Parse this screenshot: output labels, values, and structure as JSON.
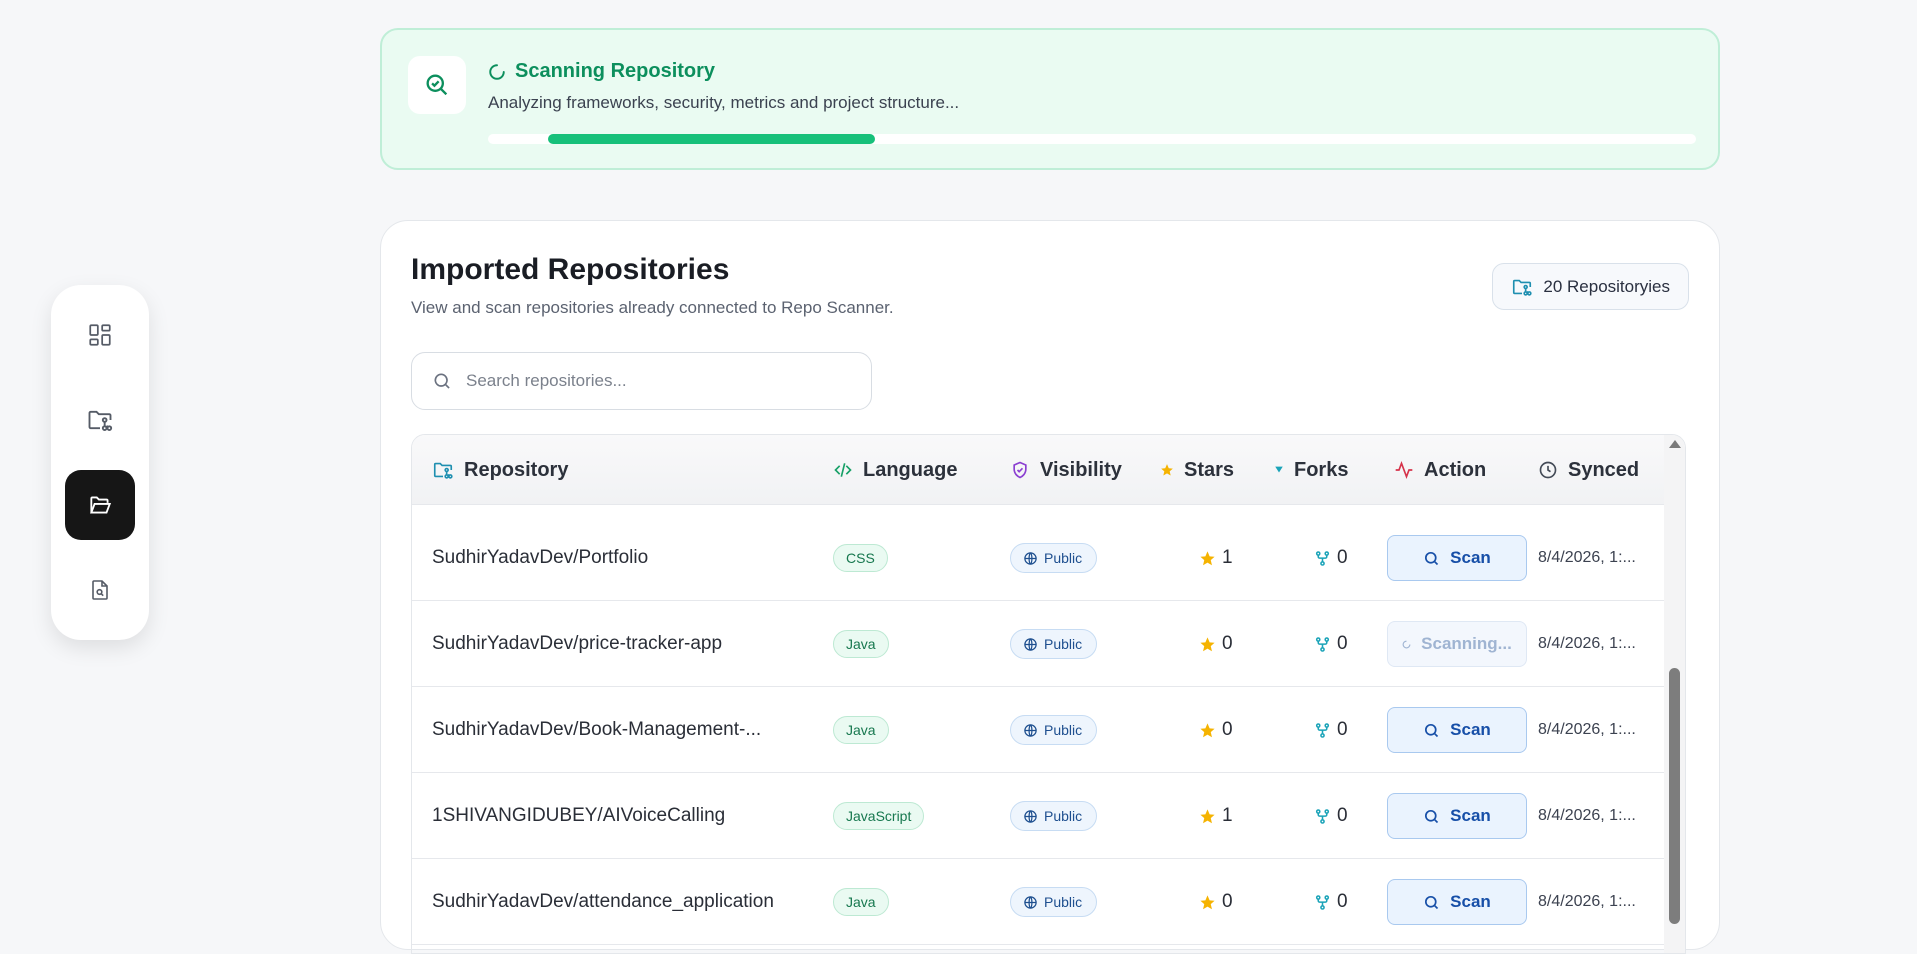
{
  "sidebar": {
    "items": [
      {
        "icon": "dashboard-icon",
        "active": false
      },
      {
        "icon": "folder-git-icon",
        "active": false
      },
      {
        "icon": "folder-open-icon",
        "active": true
      },
      {
        "icon": "file-search-icon",
        "active": false
      }
    ]
  },
  "scan_status": {
    "title": "Scanning Repository",
    "subtitle": "Analyzing frameworks, security, metrics and project structure...",
    "progress": {
      "start_fraction": 0.05,
      "end_fraction": 0.32
    }
  },
  "repos_panel": {
    "title": "Imported Repositories",
    "subtitle": "View and scan repositories already connected to Repo Scanner.",
    "count_label": "20 Repositoryies",
    "search": {
      "placeholder": "Search repositories...",
      "value": ""
    }
  },
  "table": {
    "columns": {
      "repository": "Repository",
      "language": "Language",
      "visibility": "Visibility",
      "stars": "Stars",
      "forks": "Forks",
      "action": "Action",
      "synced": "Synced"
    },
    "rows": [
      {
        "name": "SudhirYadavDev/Portfolio",
        "language": "CSS",
        "visibility": "Public",
        "stars": "1",
        "forks": "0",
        "action": "Scan",
        "action_state": "idle",
        "synced": "8/4/2026, 1:..."
      },
      {
        "name": "SudhirYadavDev/price-tracker-app",
        "language": "Java",
        "visibility": "Public",
        "stars": "0",
        "forks": "0",
        "action": "Scanning...",
        "action_state": "scanning",
        "synced": "8/4/2026, 1:..."
      },
      {
        "name": "SudhirYadavDev/Book-Management-...",
        "language": "Java",
        "visibility": "Public",
        "stars": "0",
        "forks": "0",
        "action": "Scan",
        "action_state": "idle",
        "synced": "8/4/2026, 1:..."
      },
      {
        "name": "1SHIVANGIDUBEY/AIVoiceCalling",
        "language": "JavaScript",
        "visibility": "Public",
        "stars": "1",
        "forks": "0",
        "action": "Scan",
        "action_state": "idle",
        "synced": "8/4/2026, 1:..."
      },
      {
        "name": "SudhirYadavDev/attendance_application",
        "language": "Java",
        "visibility": "Public",
        "stars": "0",
        "forks": "0",
        "action": "Scan",
        "action_state": "idle",
        "synced": "8/4/2026, 1:..."
      }
    ]
  },
  "colors": {
    "accent_green": "#16c07a",
    "scan_blue": "#174fa8",
    "star": "#f5b301",
    "fork": "#1aa3b8"
  }
}
